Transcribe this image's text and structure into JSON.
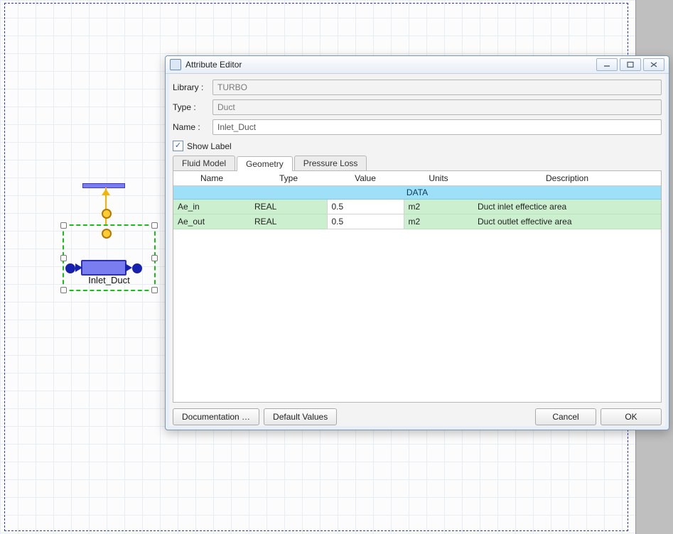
{
  "dialog": {
    "title": "Attribute Editor",
    "fields": {
      "library_label": "Library :",
      "library_value": "TURBO",
      "type_label": "Type :",
      "type_value": "Duct",
      "name_label": "Name :",
      "name_value": "Inlet_Duct"
    },
    "show_label_text": "Show Label",
    "show_label_checked": true,
    "tabs": [
      "Fluid Model",
      "Geometry",
      "Pressure Loss"
    ],
    "active_tab": "Geometry",
    "columns": [
      "Name",
      "Type",
      "Value",
      "Units",
      "Description"
    ],
    "section": "DATA",
    "rows": [
      {
        "name": "Ae_in",
        "type": "REAL",
        "value": "0.5",
        "units": "m2",
        "description": "Duct inlet effectice area"
      },
      {
        "name": "Ae_out",
        "type": "REAL",
        "value": "0.5",
        "units": "m2",
        "description": "Duct outlet effective area"
      }
    ],
    "buttons": {
      "documentation": "Documentation …",
      "defaults": "Default Values",
      "cancel": "Cancel",
      "ok": "OK"
    }
  },
  "diagram": {
    "component_label": "Inlet_Duct"
  }
}
